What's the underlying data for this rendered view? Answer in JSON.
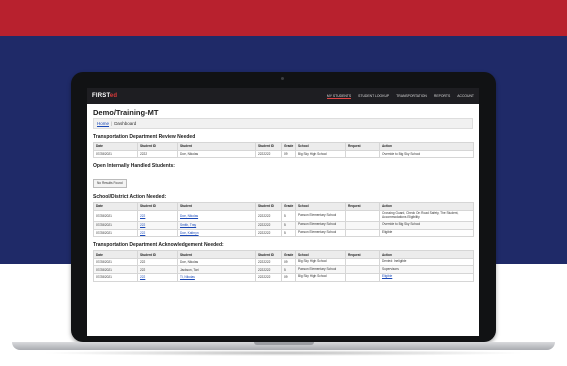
{
  "app": {
    "logo_main": "FIRST",
    "logo_sub": "ed",
    "title": "Demo/Training-MT"
  },
  "nav": [
    "My Students",
    "Student Lookup",
    "Transportation",
    "Reports",
    "Account"
  ],
  "breadcrumb": [
    "Home",
    "Dashboard"
  ],
  "sections": {
    "review": {
      "title": "Transportation Department Review Needed",
      "columns": [
        "Date",
        "Student ID",
        "Student",
        "Student ID",
        "Grade",
        "School",
        "Request",
        "Action"
      ],
      "rows": [
        [
          "07/28/2021",
          "2222",
          "Doe, Nikolas",
          "2222222",
          "09",
          "Big Sky High School",
          "",
          "Override to Big Sky School"
        ]
      ]
    },
    "internal": {
      "title": "Open Internally Handled Students:",
      "button": "No Results Found"
    },
    "district": {
      "title": "School/District Action Needed:",
      "columns": [
        "Date",
        "Student ID",
        "Student",
        "Student ID",
        "Grade",
        "School",
        "Request",
        "Action"
      ],
      "rows": [
        [
          "07/28/2021",
          "222",
          "Doe, Nikolas",
          "2222222",
          "5",
          "Paxson Elementary School",
          "",
          "Crossing Guard, Check On Road Safety, The Student, Accommodations Eligibility"
        ],
        [
          "07/28/2021",
          "222",
          "Smith, Tray",
          "2222222",
          "5",
          "Paxson Elementary School",
          "",
          "Override to Big Sky School"
        ],
        [
          "07/28/2021",
          "222",
          "Doe, Kathryn",
          "2222222",
          "5",
          "Paxson Elementary School",
          "",
          "Eligible"
        ]
      ]
    },
    "ack": {
      "title": "Transportation Department Acknowledgement Needed:",
      "columns": [
        "Date",
        "Student ID",
        "Student",
        "Student ID",
        "Grade",
        "School",
        "Request",
        "Action"
      ],
      "rows": [
        [
          "07/28/2021",
          "222",
          "Doe, Nikolas",
          "2222222",
          "09",
          "Big Sky High School",
          "",
          "Denied: Ineligible"
        ],
        [
          "07/28/2021",
          "222",
          "Jackson, Tari",
          "2222222",
          "5",
          "Paxson Elementary School",
          "",
          "Supervisors"
        ],
        [
          "07/28/2021",
          "222",
          "Tl, Nikolas",
          "2222222",
          "09",
          "Big Sky High School",
          "",
          "Eligible"
        ]
      ]
    }
  },
  "colors": {
    "red_band": "#b8212e",
    "blue_band": "#1f2a68",
    "topbar": "#1e1e22"
  }
}
